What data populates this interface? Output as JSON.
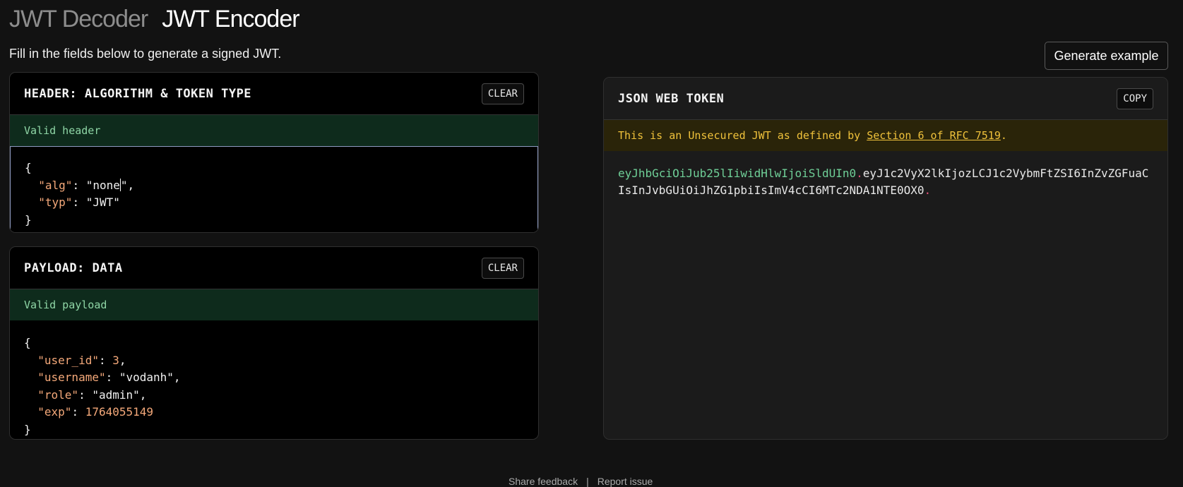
{
  "tabs": {
    "decoder": "JWT Decoder",
    "encoder": "JWT Encoder"
  },
  "subtitle": "Fill in the fields below to generate a signed JWT.",
  "generate_button": "Generate example",
  "header_panel": {
    "title": "HEADER: ALGORITHM & TOKEN TYPE",
    "clear_label": "CLEAR",
    "status": "Valid header",
    "json": {
      "open": "{",
      "close": "}",
      "alg_key": "\"alg\"",
      "alg_value_a": "\"none",
      "alg_value_b": "\"",
      "typ_key": "\"typ\"",
      "typ_value": "\"JWT\""
    }
  },
  "payload_panel": {
    "title": "PAYLOAD: DATA",
    "clear_label": "CLEAR",
    "status": "Valid payload",
    "json": {
      "open": "{",
      "close": "}",
      "user_id_key": "\"user_id\"",
      "user_id_value": "3",
      "username_key": "\"username\"",
      "username_value": "\"vodanh\"",
      "role_key": "\"role\"",
      "role_value": "\"admin\"",
      "exp_key": "\"exp\"",
      "exp_value": "1764055149"
    }
  },
  "token_panel": {
    "title": "JSON WEB TOKEN",
    "copy_label": "COPY",
    "warning_prefix": "This is an Unsecured JWT as defined by ",
    "warning_link": "Section 6 of RFC 7519",
    "warning_suffix": ".",
    "token_header": "eyJhbGciOiJub25lIiwidHlwIjoiSldUIn0",
    "token_payload": "eyJ1c2VyX2lkIjozLCJ1c2VybmFtZSI6InZvZGFuaCIsInJvbGUiOiJhZG1pbiIsImV4cCI6MTc2NDA1NTE0OX0",
    "dot": "."
  },
  "footer": {
    "feedback": "Share feedback",
    "separator": "|",
    "report": "Report issue"
  },
  "colors": {
    "background": "#121212",
    "valid_green": "#8fd6a6",
    "warning_yellow": "#f0c23b",
    "json_key": "#f5a97a",
    "token_header": "#6fcf97",
    "token_dot": "#e2507a"
  }
}
